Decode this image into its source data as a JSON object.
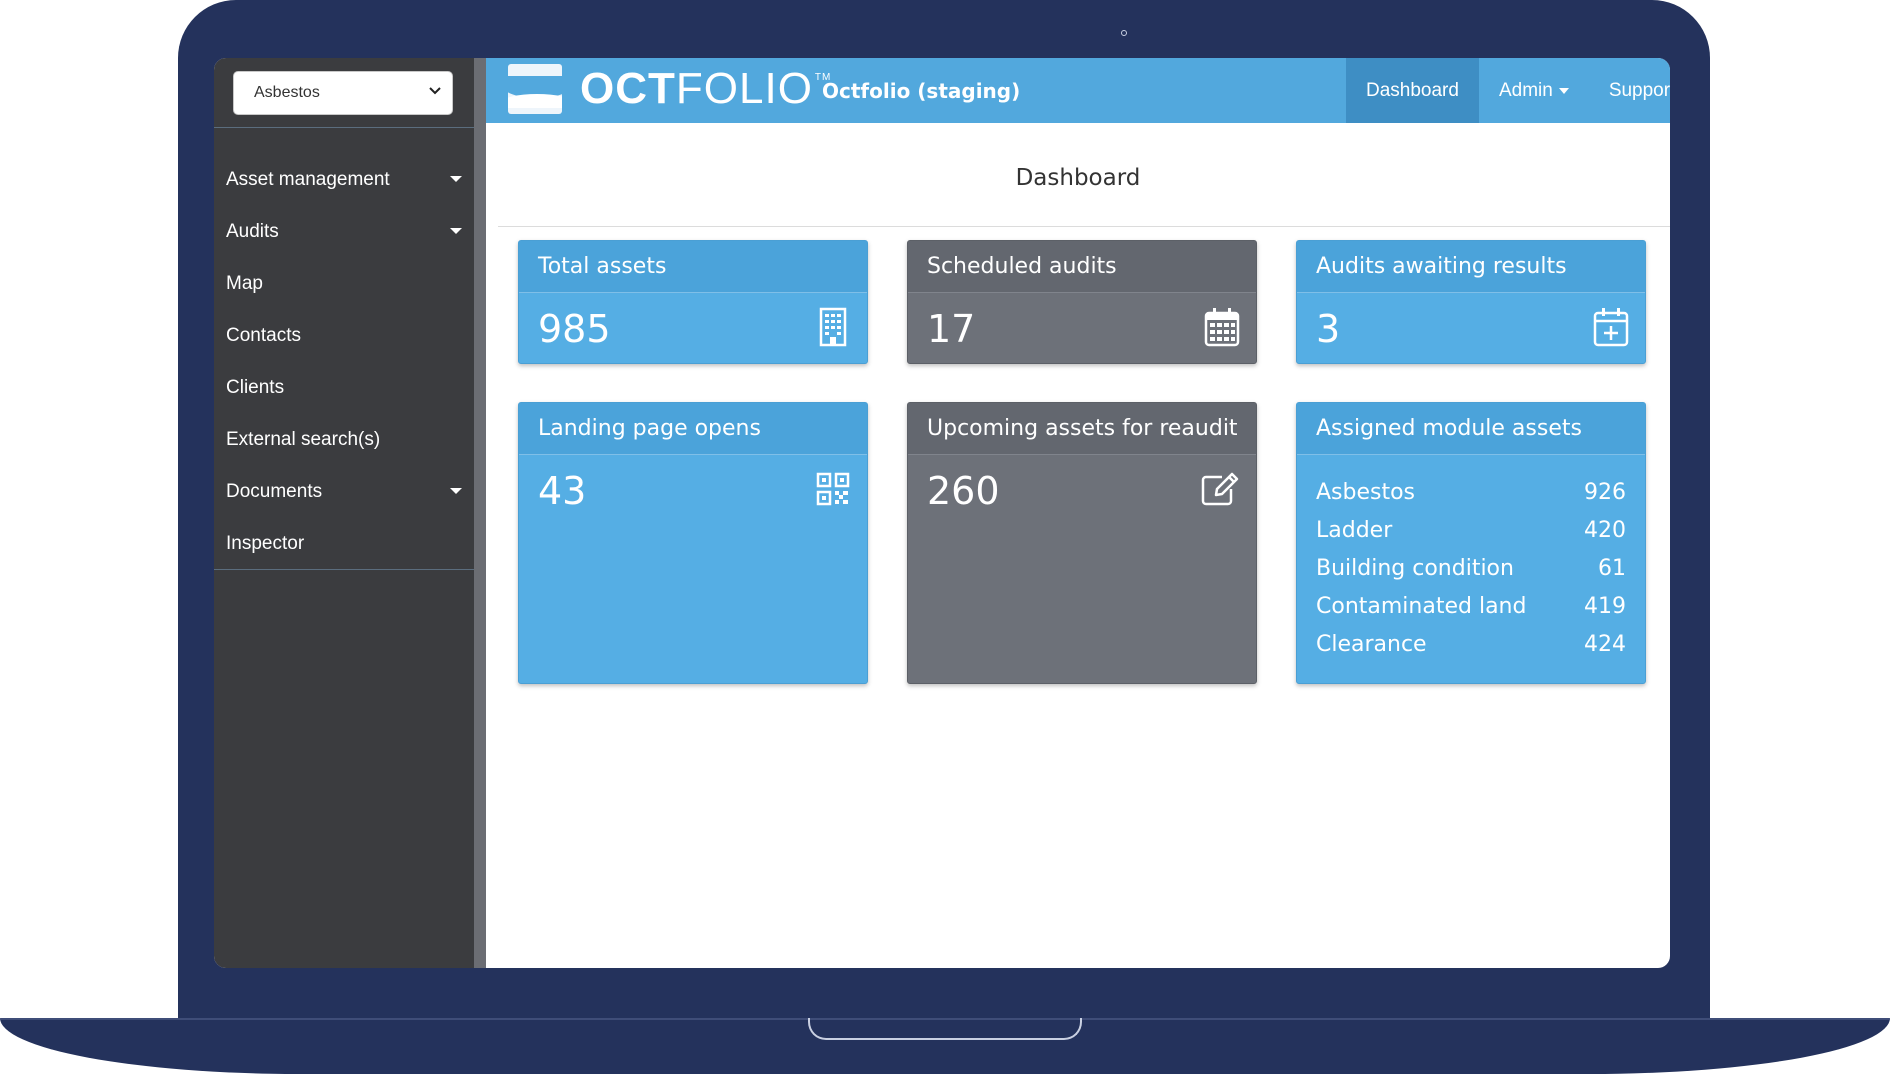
{
  "sidebar": {
    "module_select": {
      "value": "Asbestos"
    },
    "items": [
      {
        "label": "Asset management",
        "has_submenu": true
      },
      {
        "label": "Audits",
        "has_submenu": true
      },
      {
        "label": "Map",
        "has_submenu": false
      },
      {
        "label": "Contacts",
        "has_submenu": false
      },
      {
        "label": "Clients",
        "has_submenu": false
      },
      {
        "label": "External search(s)",
        "has_submenu": false
      },
      {
        "label": "Documents",
        "has_submenu": true
      },
      {
        "label": "Inspector",
        "has_submenu": false
      }
    ]
  },
  "header": {
    "logo_bold": "OCT",
    "logo_light": "FOLIO",
    "logo_tm": "TM",
    "environment_title": "Octfolio (staging)",
    "nav": [
      {
        "label": "Dashboard",
        "active": true
      },
      {
        "label": "Admin",
        "dropdown": true
      },
      {
        "label": "Support"
      }
    ]
  },
  "page": {
    "title": "Dashboard"
  },
  "cards": {
    "total_assets": {
      "title": "Total assets",
      "value": "985",
      "icon": "building-icon"
    },
    "scheduled_audits": {
      "title": "Scheduled audits",
      "value": "17",
      "icon": "calendar-icon"
    },
    "audits_awaiting": {
      "title": "Audits awaiting results",
      "value": "3",
      "icon": "calendar-plus-icon"
    },
    "landing_page": {
      "title": "Landing page opens",
      "value": "43",
      "icon": "qr-code-icon"
    },
    "upcoming_reaudit": {
      "title": "Upcoming assets for reaudit",
      "value": "260",
      "icon": "edit-icon"
    },
    "assigned_modules": {
      "title": "Assigned module assets",
      "rows": [
        {
          "name": "Asbestos",
          "count": "926"
        },
        {
          "name": "Ladder",
          "count": "420"
        },
        {
          "name": "Building condition",
          "count": "61"
        },
        {
          "name": "Contaminated land",
          "count": "419"
        },
        {
          "name": "Clearance",
          "count": "424"
        }
      ]
    }
  },
  "colors": {
    "brand_blue": "#52a8dd",
    "card_blue": "#55aee4",
    "card_grey": "#6d7179",
    "sidebar": "#3b3c3f",
    "frame": "#24325c"
  }
}
